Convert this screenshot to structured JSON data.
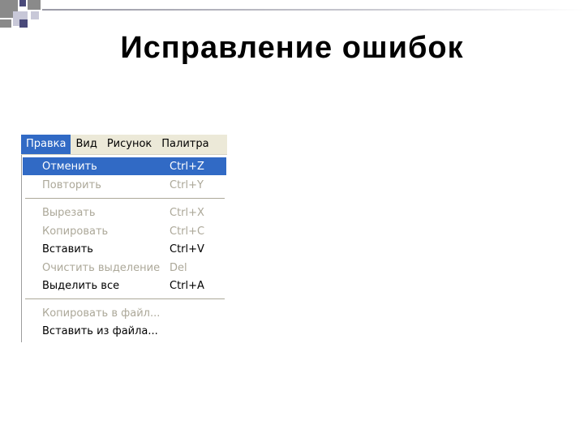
{
  "slide": {
    "title": "Исправление ошибок"
  },
  "menubar": {
    "items": [
      "Правка",
      "Вид",
      "Рисунок",
      "Палитра"
    ]
  },
  "menu": {
    "items": [
      {
        "label": "Отменить",
        "shortcut": "Ctrl+Z",
        "state": "highlighted"
      },
      {
        "label": "Повторить",
        "shortcut": "Ctrl+Y",
        "state": "disabled"
      },
      {
        "label": "Вырезать",
        "shortcut": "Ctrl+X",
        "state": "disabled"
      },
      {
        "label": "Копировать",
        "shortcut": "Ctrl+C",
        "state": "disabled"
      },
      {
        "label": "Вставить",
        "shortcut": "Ctrl+V",
        "state": "enabled"
      },
      {
        "label": "Очистить выделение",
        "shortcut": "Del",
        "state": "disabled"
      },
      {
        "label": "Выделить все",
        "shortcut": "Ctrl+A",
        "state": "enabled"
      },
      {
        "label": "Копировать в файл...",
        "shortcut": "",
        "state": "disabled"
      },
      {
        "label": "Вставить из файла...",
        "shortcut": "",
        "state": "enabled"
      }
    ]
  },
  "colors": {
    "highlight": "#316ac5",
    "menubar": "#ece9d8",
    "disabled_text": "#aca899"
  }
}
